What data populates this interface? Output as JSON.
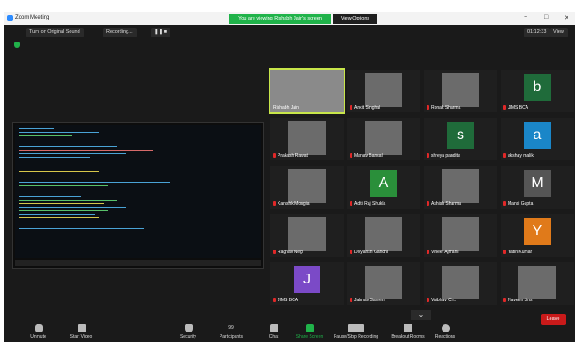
{
  "window": {
    "title": "Zoom Meeting",
    "banner": "You are viewing Rishabh Jain's screen",
    "view_options": "View Options",
    "controls": [
      "−",
      "□",
      "✕"
    ]
  },
  "toolbar": {
    "sound_button": "Turn on Original Sound",
    "recording": "Recording...",
    "timer": "01:12:33",
    "view": "View"
  },
  "participants": [
    {
      "name": "Rishabh Jain",
      "type": "photo",
      "muted": false,
      "active": true
    },
    {
      "name": "Ankit Singhal",
      "type": "photo",
      "muted": true
    },
    {
      "name": "Ronak Sharma",
      "type": "photo",
      "muted": true
    },
    {
      "name": "JIMS BCA",
      "type": "avatar",
      "letter": "b",
      "color": "#1f6b3a",
      "muted": true
    },
    {
      "name": "Prakash Rawat",
      "type": "photo",
      "muted": true
    },
    {
      "name": "Manav Bansal",
      "type": "photo",
      "muted": true
    },
    {
      "name": "shreya pandita",
      "type": "avatar",
      "letter": "s",
      "color": "#1f6b3a",
      "muted": true
    },
    {
      "name": "akshay malik",
      "type": "avatar",
      "letter": "a",
      "color": "#1a86c8",
      "muted": true
    },
    {
      "name": "Kanishk Mongia",
      "type": "photo",
      "muted": true
    },
    {
      "name": "Aditi Raj Shukla",
      "type": "avatar",
      "letter": "A",
      "color": "#2a8f3a",
      "muted": true
    },
    {
      "name": "Ashish Sharma",
      "type": "photo",
      "muted": true
    },
    {
      "name": "Mansi Gupta",
      "type": "avatar",
      "letter": "M",
      "color": "#555555",
      "muted": true
    },
    {
      "name": "Raghav Negi",
      "type": "photo",
      "muted": true
    },
    {
      "name": "Divyansh Gandhi",
      "type": "photo",
      "muted": true
    },
    {
      "name": "Vineet Ajmani",
      "type": "photo",
      "muted": true
    },
    {
      "name": "Yatin Kumar",
      "type": "avatar",
      "letter": "Y",
      "color": "#e07a1a",
      "muted": true
    },
    {
      "name": "JIMS BCA",
      "type": "avatar",
      "letter": "J",
      "color": "#7b4ac7",
      "muted": true
    },
    {
      "name": "Jahnav Sareen",
      "type": "photo",
      "muted": true
    },
    {
      "name": "Vaibhav Ch..",
      "type": "photo",
      "muted": true
    },
    {
      "name": "Naveen Jins",
      "type": "photo",
      "muted": true
    }
  ],
  "bottom": {
    "unmute": "Unmute",
    "start_video": "Start Video",
    "security": "Security",
    "participants": "Participants",
    "participant_count": "99",
    "chat": "Chat",
    "share_screen": "Share Screen",
    "record": "Pause/Stop Recording",
    "breakout": "Breakout Rooms",
    "reactions": "Reactions",
    "leave": "Leave"
  },
  "colors": {
    "accent_green": "#20b34a",
    "leave_red": "#c91a1a",
    "active_speaker": "#c8e64a"
  }
}
